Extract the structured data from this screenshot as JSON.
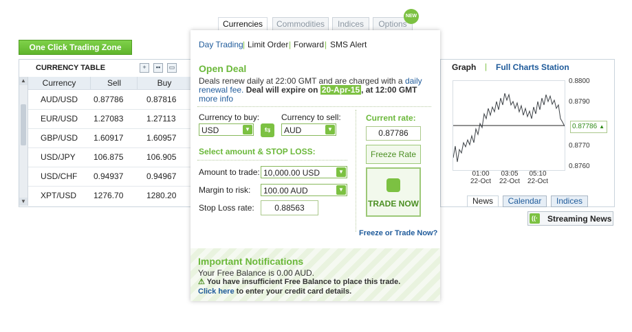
{
  "one_click": "One Click Trading Zone",
  "currency_table": {
    "title": "CURRENCY TABLE",
    "icons": [
      "plus-icon",
      "grid-icon",
      "window-icon"
    ],
    "headers": [
      "Currency",
      "Sell",
      "Buy"
    ],
    "rows": [
      {
        "pair": "AUD/USD",
        "sell": "0.87786",
        "buy": "0.87816"
      },
      {
        "pair": "EUR/USD",
        "sell": "1.27083",
        "buy": "1.27113"
      },
      {
        "pair": "GBP/USD",
        "sell": "1.60917",
        "buy": "1.60957"
      },
      {
        "pair": "USD/JPY",
        "sell": "106.875",
        "buy": "106.905"
      },
      {
        "pair": "USD/CHF",
        "sell": "0.94937",
        "buy": "0.94967"
      },
      {
        "pair": "XPT/USD",
        "sell": "1276.70",
        "buy": "1280.20"
      }
    ]
  },
  "tabs": {
    "currencies": "Currencies",
    "commodities": "Commodities",
    "indices": "Indices",
    "options": "Options",
    "new_badge": "NEW"
  },
  "subnav": {
    "day_trading": "Day Trading",
    "limit_order": "Limit Order",
    "forward": "Forward",
    "sms_alert": "SMS Alert",
    "separator": "|"
  },
  "deal": {
    "title": "Open Deal",
    "info_part1": "Deals renew daily at 22:00 GMT and are charged with a",
    "info_link1": "daily renewal fee.",
    "info_part2": "Deal will expire on",
    "expire_date": "20-Apr-15",
    "info_part3": ", at 12:00 GMT",
    "info_link2": "more info",
    "currency_to_buy_label": "Currency to buy:",
    "currency_to_buy": "USD",
    "currency_to_sell_label": "Currency to sell:",
    "currency_to_sell": "AUD",
    "select_amount_label": "Select amount & STOP LOSS:",
    "amount_label": "Amount to trade:",
    "amount_value": "10,000.00 USD",
    "margin_label": "Margin to risk:",
    "margin_value": "100.00 AUD",
    "stoploss_label": "Stop Loss rate:",
    "stoploss_value": "0.88563",
    "current_rate_label": "Current rate:",
    "current_rate": "0.87786",
    "freeze_rate": "Freeze Rate",
    "trade_now": "TRADE NOW",
    "freeze_or_trade": "Freeze or Trade Now?"
  },
  "notifications": {
    "title": "Important Notifications",
    "balance": "Your Free Balance is 0.00 AUD.",
    "warning": "You have insufficient Free Balance to place this trade.",
    "click_here": "Click here",
    "click_rest": "to enter your credit card details."
  },
  "graph": {
    "title": "Graph",
    "full_charts": "Full Charts Station",
    "y_ticks": [
      "0.8800",
      "0.8790",
      "0.8770",
      "0.8760"
    ],
    "current_value": "0.87786",
    "x_ticks": [
      {
        "time": "01:00",
        "date": "22-Oct"
      },
      {
        "time": "03:05",
        "date": "22-Oct"
      },
      {
        "time": "05:10",
        "date": "22-Oct"
      }
    ],
    "tabs": [
      "News",
      "Calendar",
      "Indices"
    ]
  },
  "streaming_news": "Streaming News",
  "colors": {
    "accent_green": "#7cc142",
    "link_blue": "#1e5a9a",
    "highlight": "#7cc142"
  }
}
